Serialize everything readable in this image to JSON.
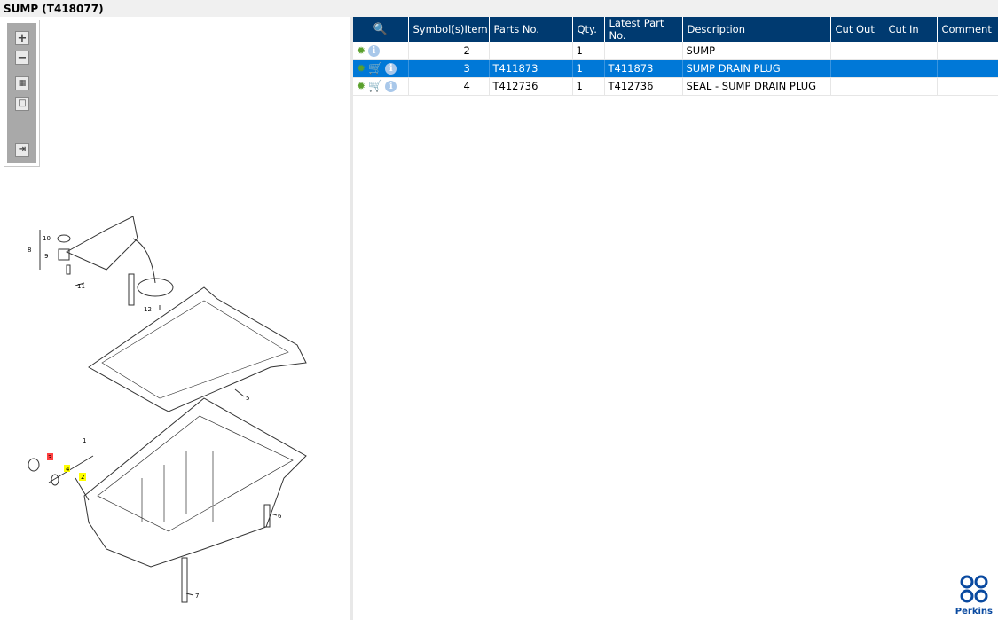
{
  "title": "SUMP (T418077)",
  "toolbar": {
    "zoom_in": "+",
    "zoom_out": "−",
    "fit": "fit",
    "actual": "actual",
    "export": "export"
  },
  "diagram": {
    "callouts": [
      "1",
      "2",
      "3",
      "4",
      "5",
      "6",
      "7",
      "8",
      "9",
      "10",
      "11",
      "12"
    ]
  },
  "table": {
    "headers": [
      "",
      "Symbol(s)",
      "Item",
      "Parts No.",
      "Qty.",
      "Latest Part No.",
      "Description",
      "Cut Out",
      "Cut In",
      "Comment"
    ],
    "rows": [
      {
        "item": "2",
        "part": "",
        "qty": "1",
        "latest": "",
        "desc": "SUMP",
        "cart": false
      },
      {
        "item": "3",
        "part": "T411873",
        "qty": "1",
        "latest": "T411873",
        "desc": "SUMP DRAIN PLUG",
        "cart": true,
        "selected": true
      },
      {
        "item": "4",
        "part": "T412736",
        "qty": "1",
        "latest": "T412736",
        "desc": "SEAL - SUMP DRAIN PLUG",
        "cart": true
      }
    ]
  },
  "logo": {
    "text": "Perkins"
  },
  "colors": {
    "header": "#003a70",
    "selected": "#0078d7",
    "highlight": "#ffff00"
  }
}
